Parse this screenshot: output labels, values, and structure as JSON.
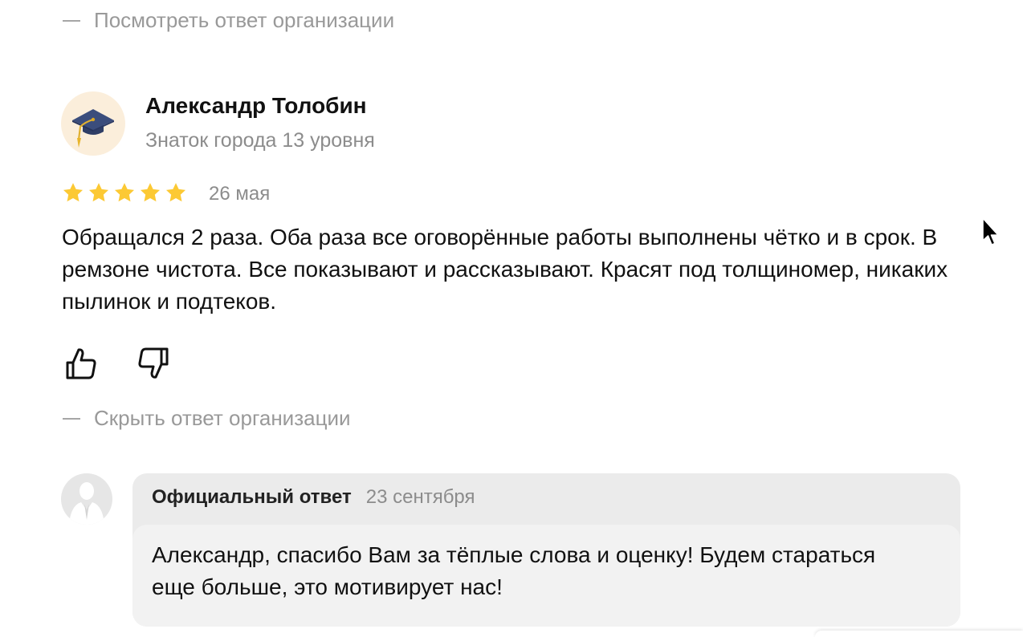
{
  "top_toggle": {
    "label": "Посмотреть ответ организации"
  },
  "review": {
    "author": {
      "name": "Александр Толобин",
      "level": "Знаток города 13 уровня",
      "avatar_icon": "graduation-cap-icon"
    },
    "rating": 5,
    "rating_max": 5,
    "date": "26 мая",
    "text": "Обращался 2 раза. Оба раза все оговорённые работы выполнены чётко и в срок. В ремзоне чистота. Все показывают и рассказывают. Красят под толщиномер, никаких пылинок и подтеков.",
    "actions": {
      "like_icon": "thumbs-up-icon",
      "dislike_icon": "thumbs-down-icon"
    }
  },
  "answer_toggle": {
    "label": "Скрыть ответ организации"
  },
  "official_answer": {
    "title": "Официальный ответ",
    "date": "23 сентября",
    "text": "Александр, спасибо Вам за тёплые слова и оценку! Будем стараться еще больше, это мотивирует нас!",
    "avatar_icon": "person-silhouette-icon"
  },
  "colors": {
    "star": "#fcc934",
    "muted_text": "#999999",
    "answer_header_bg": "#ebebeb",
    "answer_body_bg": "#f2f2f2",
    "avatar_bg": "#fbeedb"
  }
}
